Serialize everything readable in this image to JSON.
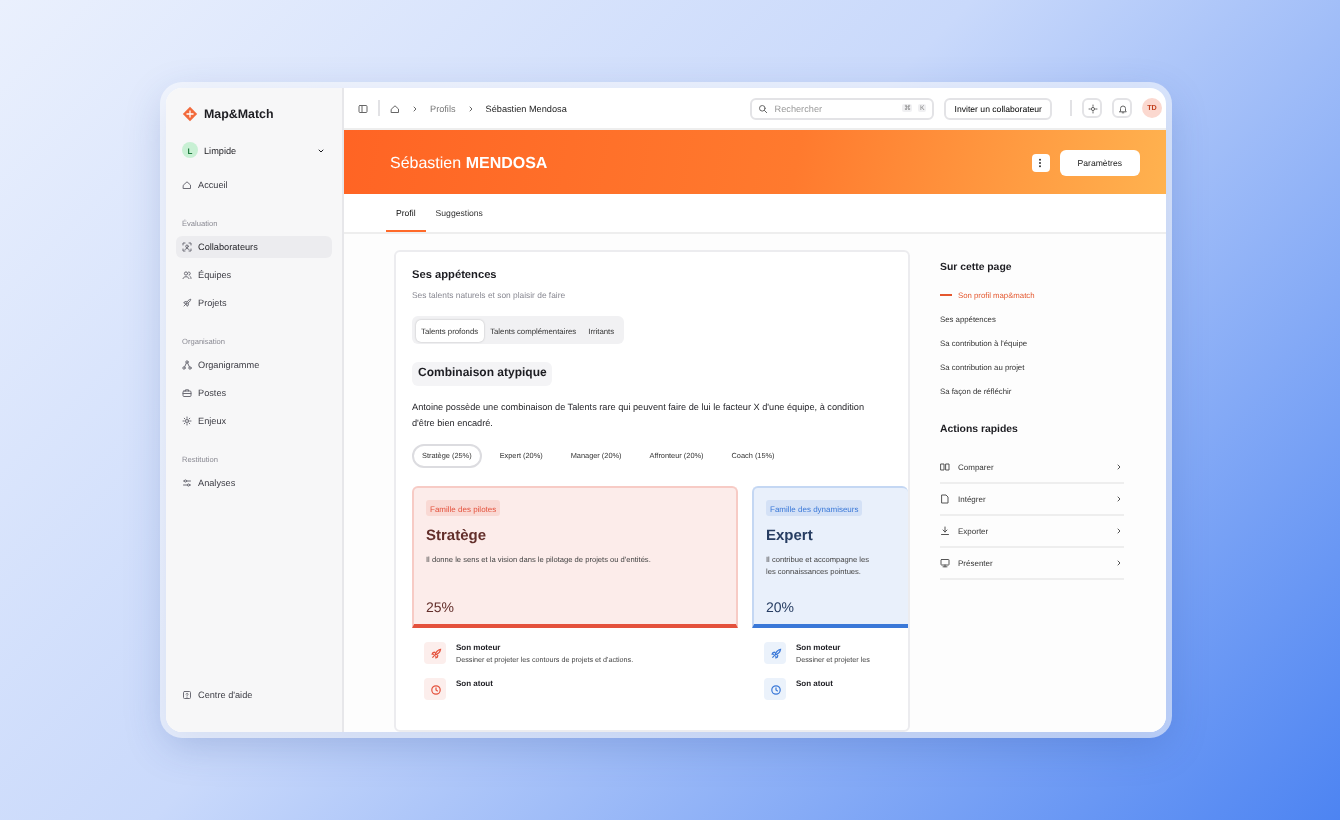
{
  "sidebar": {
    "brand": "Map&Match",
    "workspace": {
      "initial": "L",
      "name": "Limpide"
    },
    "sections": [
      {
        "items": [
          {
            "label": "Accueil",
            "selected": false
          }
        ]
      },
      {
        "heading": "Évaluation",
        "items": [
          {
            "label": "Collaborateurs",
            "selected": true
          },
          {
            "label": "Équipes",
            "selected": false
          },
          {
            "label": "Projets",
            "selected": false
          }
        ]
      },
      {
        "heading": "Organisation",
        "items": [
          {
            "label": "Organigramme",
            "selected": false
          },
          {
            "label": "Postes",
            "selected": false
          },
          {
            "label": "Enjeux",
            "selected": false
          }
        ]
      },
      {
        "heading": "Restitution",
        "items": [
          {
            "label": "Analyses",
            "selected": false
          }
        ]
      }
    ],
    "footer": "Centre d'aide"
  },
  "topbar": {
    "breadcrumb": [
      "Profils",
      "Sébastien Mendosa"
    ],
    "search": {
      "placeholder": "Rechercher",
      "shortcut": [
        "⌘",
        "K"
      ]
    },
    "invite_button": "Inviter un collaborateur",
    "avatar": "TD"
  },
  "banner": {
    "name": "Sébastien **MENDOSA**",
    "button": "Paramètres"
  },
  "tabs": [
    {
      "label": "Profil",
      "selected": true
    },
    {
      "label": "Suggestions",
      "selected": false
    }
  ],
  "section": {
    "title": "Ses appétences",
    "subtitle": "Ses talents naturels et son plaisir de faire",
    "segments": [
      {
        "label": "Talents profonds",
        "selected": true
      },
      {
        "label": "Talents complémentaires",
        "selected": false
      },
      {
        "label": "Irritants",
        "selected": false
      }
    ],
    "combo_title": "Combinaison atypique",
    "combo_text": "Antoine possède une combinaison de Talents rare qui peuvent faire de lui le facteur X d'une équipe, à condition d'être bien encadré.",
    "chips": [
      {
        "label": "Stratège (25%)",
        "selected": true
      },
      {
        "label": "Expert (20%)",
        "selected": false
      },
      {
        "label": "Manager (20%)",
        "selected": false
      },
      {
        "label": "Affronteur (20%)",
        "selected": false
      },
      {
        "label": "Coach (15%)",
        "selected": false
      }
    ],
    "cards": [
      {
        "family": "Famille des pilotes",
        "color": "#e4513c",
        "title": "Stratège",
        "description": "Il donne le sens et la vision dans le pilotage de projets ou d'entités.",
        "percent": "25%",
        "rows": [
          {
            "title": "Son moteur",
            "text": "Dessiner et projeter les contours de projets et d'actions."
          },
          {
            "title": "Son atout"
          }
        ]
      },
      {
        "family": "Famille des dynamiseurs",
        "color": "#3a78d8",
        "title": "Expert",
        "description": "Il contribue et accompagne les",
        "description_2": "les connaissances pointues.",
        "percent": "20%",
        "rows": [
          {
            "title": "Son moteur",
            "text": "Dessiner et projeter les"
          },
          {
            "title": "Son atout"
          }
        ]
      }
    ]
  },
  "aside": {
    "toc_title": "Sur cette page",
    "toc": [
      {
        "label": "Son profil map&match",
        "selected": true
      },
      {
        "label": "Ses appétences",
        "selected": false
      },
      {
        "label": "Sa contribution à l'équipe",
        "selected": false
      },
      {
        "label": "Sa contribution au projet",
        "selected": false
      },
      {
        "label": "Sa façon de réfléchir",
        "selected": false
      }
    ],
    "actions_title": "Actions rapides",
    "actions": [
      "Comparer",
      "Intégrer",
      "Exporter",
      "Présenter"
    ]
  }
}
